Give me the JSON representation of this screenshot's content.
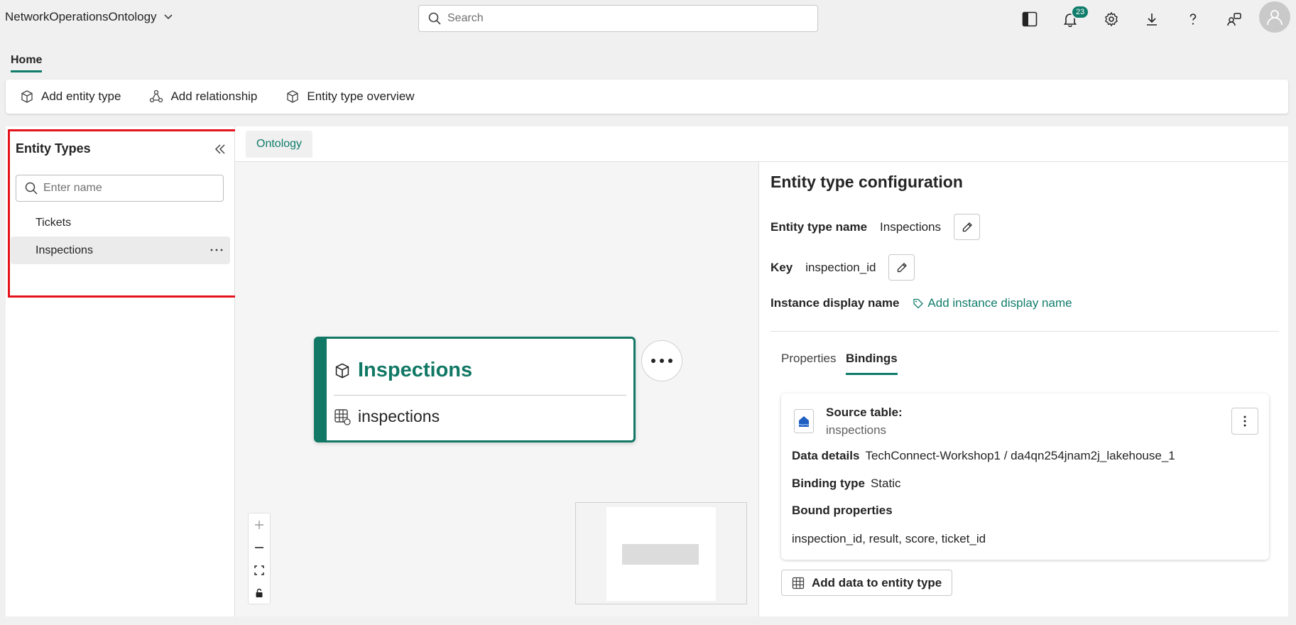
{
  "header": {
    "app_title": "NetworkOperationsOntology",
    "search_placeholder": "Search",
    "notification_count": "23"
  },
  "ribbon": {
    "tab_home": "Home",
    "buttons": [
      "Add entity type",
      "Add relationship",
      "Entity type overview"
    ]
  },
  "sidebar": {
    "title": "Entity Types",
    "search_placeholder": "Enter name",
    "items": [
      {
        "label": "Tickets"
      },
      {
        "label": "Inspections"
      }
    ],
    "more": "···"
  },
  "canvas": {
    "tab": "Ontology",
    "node": {
      "title": "Inspections",
      "source": "inspections"
    }
  },
  "config": {
    "title": "Entity type configuration",
    "entity_type_name_label": "Entity type name",
    "entity_type_name_value": "Inspections",
    "key_label": "Key",
    "key_value": "inspection_id",
    "instance_display_label": "Instance display name",
    "instance_display_link": "Add instance display name",
    "tabs": [
      "Properties",
      "Bindings"
    ],
    "card": {
      "source_table_label": "Source table:",
      "source_table_value": "inspections",
      "data_details_label": "Data details",
      "data_details_value": "TechConnect-Workshop1 / da4qn254jnam2j_lakehouse_1",
      "binding_type_label": "Binding type",
      "binding_type_value": "Static",
      "bound_properties_label": "Bound properties",
      "bound_properties_value": "inspection_id, result, score, ticket_id"
    },
    "add_data_button": "Add data to entity type"
  },
  "colors": {
    "accent": "#107c6b",
    "highlight": "#e3121b"
  }
}
